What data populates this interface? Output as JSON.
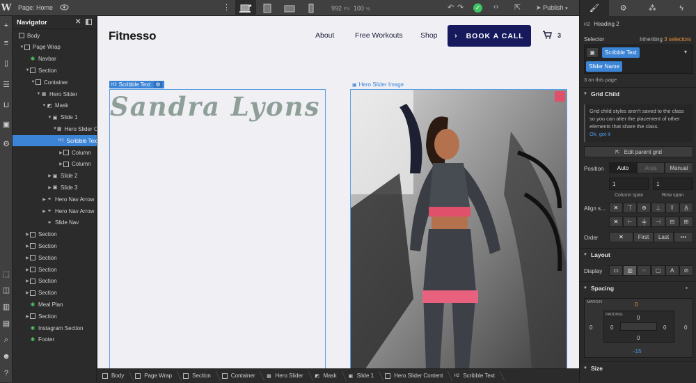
{
  "topbar": {
    "page_prefix": "Page:",
    "page_name": "Home",
    "width_value": "992",
    "width_unit": "PX",
    "zoom_value": "100",
    "zoom_unit": "%",
    "publish_label": "Publish"
  },
  "navigator": {
    "title": "Navigator",
    "items": [
      {
        "label": "Body",
        "depth": 0,
        "caret": "",
        "icon": "square"
      },
      {
        "label": "Page Wrap",
        "depth": 1,
        "caret": "down",
        "icon": "square"
      },
      {
        "label": "Navbar",
        "depth": 2,
        "caret": "",
        "icon": "component"
      },
      {
        "label": "Section",
        "depth": 2,
        "caret": "down",
        "icon": "square"
      },
      {
        "label": "Container",
        "depth": 3,
        "caret": "down",
        "icon": "square"
      },
      {
        "label": "Hero Slider",
        "depth": 4,
        "caret": "down",
        "icon": "grid"
      },
      {
        "label": "Mask",
        "depth": 5,
        "caret": "down",
        "icon": "image"
      },
      {
        "label": "Slide 1",
        "depth": 6,
        "caret": "down",
        "icon": "slide"
      },
      {
        "label": "Hero Slider Content",
        "depth": 7,
        "caret": "down",
        "icon": "grid"
      },
      {
        "label": "Scribble Text",
        "depth": 8,
        "caret": "",
        "icon": "h2",
        "selected": true
      },
      {
        "label": "Column",
        "depth": 8,
        "caret": "right",
        "icon": "square"
      },
      {
        "label": "Column",
        "depth": 8,
        "caret": "right",
        "icon": "square"
      },
      {
        "label": "Slide 2",
        "depth": 6,
        "caret": "right",
        "icon": "slide"
      },
      {
        "label": "Slide 3",
        "depth": 6,
        "caret": "right",
        "icon": "slide"
      },
      {
        "label": "Hero Nav Arrow",
        "depth": 5,
        "caret": "right",
        "icon": "link"
      },
      {
        "label": "Hero Nav Arrow",
        "depth": 5,
        "caret": "right",
        "icon": "link"
      },
      {
        "label": "Slide Nav",
        "depth": 5,
        "caret": "",
        "icon": "link"
      },
      {
        "label": "Section",
        "depth": 2,
        "caret": "right",
        "icon": "square"
      },
      {
        "label": "Section",
        "depth": 2,
        "caret": "right",
        "icon": "square"
      },
      {
        "label": "Section",
        "depth": 2,
        "caret": "right",
        "icon": "square"
      },
      {
        "label": "Section",
        "depth": 2,
        "caret": "right",
        "icon": "square"
      },
      {
        "label": "Section",
        "depth": 2,
        "caret": "right",
        "icon": "square"
      },
      {
        "label": "Section",
        "depth": 2,
        "caret": "right",
        "icon": "square"
      },
      {
        "label": "Meal Plan",
        "depth": 2,
        "caret": "",
        "icon": "component"
      },
      {
        "label": "Section",
        "depth": 2,
        "caret": "right",
        "icon": "square"
      },
      {
        "label": "Instagram Section",
        "depth": 2,
        "caret": "",
        "icon": "component"
      },
      {
        "label": "Footer",
        "depth": 2,
        "caret": "",
        "icon": "component"
      }
    ]
  },
  "site": {
    "logo": "Fitnesso",
    "links": [
      "About",
      "Free Workouts",
      "Shop"
    ],
    "cta_label": "BOOK A CALL",
    "cart_count": "3",
    "scribble_badge": "Scribble Text",
    "scribble_text": "Sandra Lyons",
    "image_badge": "Hero Slider Image"
  },
  "breadcrumb": [
    {
      "label": "Body",
      "icon": "square"
    },
    {
      "label": "Page Wrap",
      "icon": "square"
    },
    {
      "label": "Section",
      "icon": "square"
    },
    {
      "label": "Container",
      "icon": "square"
    },
    {
      "label": "Hero Slider",
      "icon": "grid"
    },
    {
      "label": "Mask",
      "icon": "image"
    },
    {
      "label": "Slide 1",
      "icon": "slide"
    },
    {
      "label": "Hero Slider Content",
      "icon": "square"
    },
    {
      "label": "Scribble Text",
      "icon": "h2"
    }
  ],
  "panel": {
    "element_type": "Heading 2",
    "selector_label": "Selector",
    "inheriting_label": "Inheriting",
    "inheriting_count": "3 selectors",
    "chip_1": "Scribble Text",
    "chip_2": "Slider Name",
    "on_page": "3 on this page",
    "grid_child_title": "Grid Child",
    "grid_note": "Grid child styles aren't saved to the class so you can alter the placement of other elements that share the class.",
    "ok_link": "Ok, got it",
    "edit_grid": "Edit parent grid",
    "position_label": "Position",
    "pos_auto": "Auto",
    "pos_area": "Area",
    "pos_manual": "Manual",
    "col_span_value": "1",
    "row_span_value": "1",
    "col_span_label": "Column span",
    "row_span_label": "Row span",
    "align_label": "Align s...",
    "order_label": "Order",
    "order_first": "First",
    "order_last": "Last",
    "order_more": "•••",
    "layout_title": "Layout",
    "display_label": "Display",
    "spacing_title": "Spacing",
    "margin_label": "MARGIN",
    "padding_label": "PADDING",
    "margin_top": "0",
    "margin_left": "0",
    "margin_right": "0",
    "margin_bottom": "-15",
    "padding_top": "0",
    "padding_left": "0",
    "padding_right": "0",
    "padding_bottom": "0",
    "size_title": "Size"
  },
  "colors": {
    "accent": "#3b84d6",
    "cta": "#161a5c",
    "scribble": "#8e9f98",
    "margin_orange": "#e8913a",
    "margin_blue": "#4c9cf0"
  }
}
